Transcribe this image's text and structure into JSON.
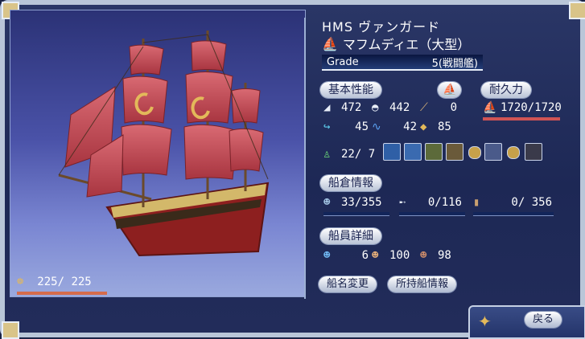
{
  "ship": {
    "title": "HMS ヴァンガード",
    "type": "マフムディエ（大型）",
    "grade_label": "Grade",
    "grade_value": "5(戦闘艦)",
    "crew_readout": "225/ 225"
  },
  "sections": {
    "basic": "基本性能",
    "durability": "耐久力",
    "cargo": "船倉情報",
    "crew": "船員詳細"
  },
  "basic_stats": {
    "vertical_sail": "472",
    "horizontal_sail": "442",
    "rowing": "0",
    "turning": "45",
    "wave_resistance": "42",
    "armor": "85"
  },
  "durability_value": "1720/1720",
  "cannons": "22/ 7",
  "cargo": {
    "sailors": "33/355",
    "cannons": "0/116",
    "goods": "0/ 356"
  },
  "crew_detail": {
    "fighters": "6",
    "navigators": "100",
    "workers": "98"
  },
  "buttons": {
    "rename": "船名変更",
    "owned_ships": "所持船情報",
    "back": "戻る"
  },
  "colors": {
    "sail": "#c3454f",
    "hull": "#8d1f1f",
    "accent": "#e3b95a"
  }
}
